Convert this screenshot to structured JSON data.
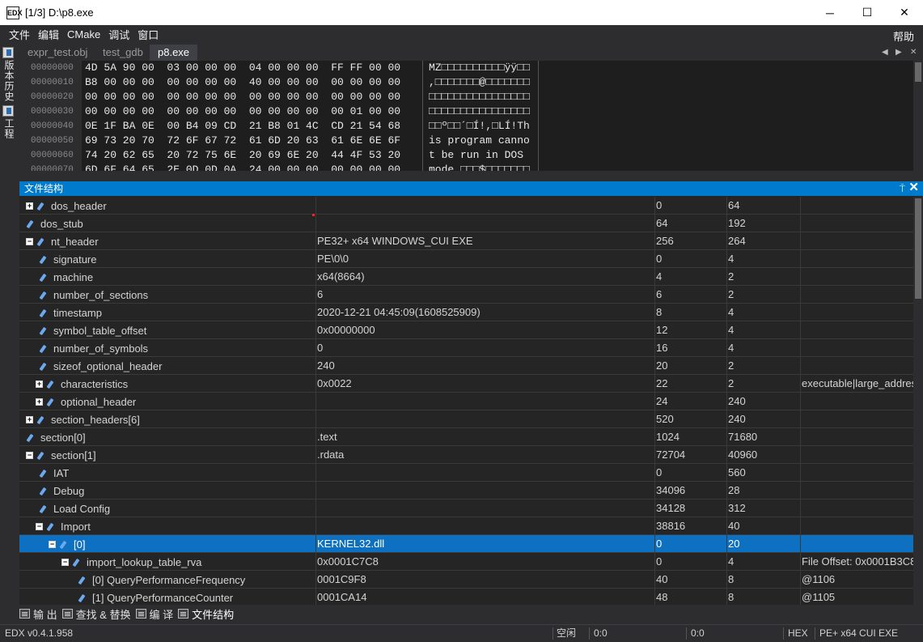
{
  "window": {
    "app_icon": "EDX",
    "title": "[1/3] D:\\p8.exe",
    "minimize": "─",
    "maximize": "☐",
    "close": "✕"
  },
  "menu": {
    "items": [
      "文件",
      "编辑",
      "CMake",
      "调试",
      "窗口"
    ],
    "help": "帮助"
  },
  "sidebar": {
    "history": "版本历史",
    "project": "工程"
  },
  "tabs": [
    {
      "label": "expr_test.obj",
      "active": false
    },
    {
      "label": "test_gdb",
      "active": false
    },
    {
      "label": "p8.exe",
      "active": true
    }
  ],
  "tab_nav": {
    "left": "◀",
    "right": "▶",
    "close": "✕"
  },
  "hex": {
    "addresses": [
      "00000000",
      "00000010",
      "00000020",
      "00000030",
      "00000040",
      "00000050",
      "00000060",
      "00000070"
    ],
    "lines": [
      "4D 5A 90 00  03 00 00 00  04 00 00 00  FF FF 00 00",
      "B8 00 00 00  00 00 00 00  40 00 00 00  00 00 00 00",
      "00 00 00 00  00 00 00 00  00 00 00 00  00 00 00 00",
      "00 00 00 00  00 00 00 00  00 00 00 00  00 01 00 00",
      "0E 1F BA 0E  00 B4 09 CD  21 B8 01 4C  CD 21 54 68",
      "69 73 20 70  72 6F 67 72  61 6D 20 63  61 6E 6E 6F",
      "74 20 62 65  20 72 75 6E  20 69 6E 20  44 4F 53 20",
      "6D 6F 64 65  2E 0D 0D 0A  24 00 00 00  00 00 00 00"
    ],
    "ascii": [
      "MZ□□□□□□□□□□ÿÿ□□",
      ",□□□□□□□@□□□□□□□",
      "□□□□□□□□□□□□□□□□",
      "□□□□□□□□□□□□□□□□",
      "□□º□□´□Í!,□LÍ!Th",
      "is program canno",
      "t be run in DOS ",
      "mode.□□□$□□□□□□□"
    ]
  },
  "panel": {
    "title": "文件结构",
    "pin": "⍑",
    "close": "✕"
  },
  "rows": [
    {
      "indent": 0,
      "expander": "+",
      "name": "dos_header",
      "value": "",
      "offset": "0",
      "size": "64",
      "desc": ""
    },
    {
      "indent": 1,
      "expander": "",
      "name": "dos_stub",
      "value": "",
      "offset": "64",
      "size": "192",
      "desc": ""
    },
    {
      "indent": 0,
      "expander": "−",
      "name": "nt_header",
      "value": "PE32+ x64 WINDOWS_CUI EXE",
      "offset": "256",
      "size": "264",
      "desc": ""
    },
    {
      "indent": 2,
      "expander": "",
      "name": "signature",
      "value": "PE\\0\\0",
      "offset": "0",
      "size": "4",
      "desc": ""
    },
    {
      "indent": 2,
      "expander": "",
      "name": "machine",
      "value": "x64(8664)",
      "offset": "4",
      "size": "2",
      "desc": ""
    },
    {
      "indent": 2,
      "expander": "",
      "name": "number_of_sections",
      "value": "6",
      "offset": "6",
      "size": "2",
      "desc": ""
    },
    {
      "indent": 2,
      "expander": "",
      "name": "timestamp",
      "value": "2020-12-21 04:45:09(1608525909)",
      "offset": "8",
      "size": "4",
      "desc": ""
    },
    {
      "indent": 2,
      "expander": "",
      "name": "symbol_table_offset",
      "value": "0x00000000",
      "offset": "12",
      "size": "4",
      "desc": ""
    },
    {
      "indent": 2,
      "expander": "",
      "name": "number_of_symbols",
      "value": "0",
      "offset": "16",
      "size": "4",
      "desc": ""
    },
    {
      "indent": 2,
      "expander": "",
      "name": "sizeof_optional_header",
      "value": "240",
      "offset": "20",
      "size": "2",
      "desc": ""
    },
    {
      "indent": 3,
      "expander": "+",
      "name": "characteristics",
      "value": "0x0022",
      "offset": "22",
      "size": "2",
      "desc": "executable|large_address"
    },
    {
      "indent": 3,
      "expander": "+",
      "name": "optional_header",
      "value": "",
      "offset": "24",
      "size": "240",
      "desc": ""
    },
    {
      "indent": 0,
      "expander": "+",
      "name": "section_headers[6]",
      "value": "",
      "offset": "520",
      "size": "240",
      "desc": ""
    },
    {
      "indent": 1,
      "expander": "",
      "name": "section[0]",
      "value": ".text",
      "offset": "1024",
      "size": "71680",
      "desc": ""
    },
    {
      "indent": 0,
      "expander": "−",
      "name": "section[1]",
      "value": ".rdata",
      "offset": "72704",
      "size": "40960",
      "desc": ""
    },
    {
      "indent": 2,
      "expander": "",
      "name": "IAT",
      "value": "",
      "offset": "0",
      "size": "560",
      "desc": ""
    },
    {
      "indent": 2,
      "expander": "",
      "name": "Debug",
      "value": "",
      "offset": "34096",
      "size": "28",
      "desc": ""
    },
    {
      "indent": 2,
      "expander": "",
      "name": "Load Config",
      "value": "",
      "offset": "34128",
      "size": "312",
      "desc": ""
    },
    {
      "indent": 3,
      "expander": "−",
      "name": "Import",
      "value": "",
      "offset": "38816",
      "size": "40",
      "desc": ""
    },
    {
      "indent": 4,
      "expander": "−",
      "name": "[0]",
      "value": "KERNEL32.dll",
      "offset": "0",
      "size": "20",
      "desc": "",
      "selected": true
    },
    {
      "indent": 5,
      "expander": "−",
      "name": "import_lookup_table_rva",
      "value": "0x0001C7C8",
      "offset": "0",
      "size": "4",
      "desc": "File Offset: 0x0001B3C8"
    },
    {
      "indent": 6,
      "expander": "",
      "name": "[0] QueryPerformanceFrequency",
      "value": "0001C9F8",
      "offset": "40",
      "size": "8",
      "desc": "@1106"
    },
    {
      "indent": 6,
      "expander": "",
      "name": "[1] QueryPerformanceCounter",
      "value": "0001CA14",
      "offset": "48",
      "size": "8",
      "desc": "@1105"
    }
  ],
  "bottom_tabs": [
    {
      "label": "输 出",
      "icon": "output-icon"
    },
    {
      "label": "查找 & 替换",
      "icon": "find-replace-icon"
    },
    {
      "label": "编 译",
      "icon": "build-icon"
    },
    {
      "label": "文件结构",
      "icon": "file-structure-icon",
      "active": true
    }
  ],
  "status": {
    "version": "EDX v0.4.1.958",
    "state": "空闲",
    "pos1": "0:0",
    "pos2": "0:0",
    "mode": "HEX",
    "filetype": "PE+ x64 CUI EXE"
  }
}
